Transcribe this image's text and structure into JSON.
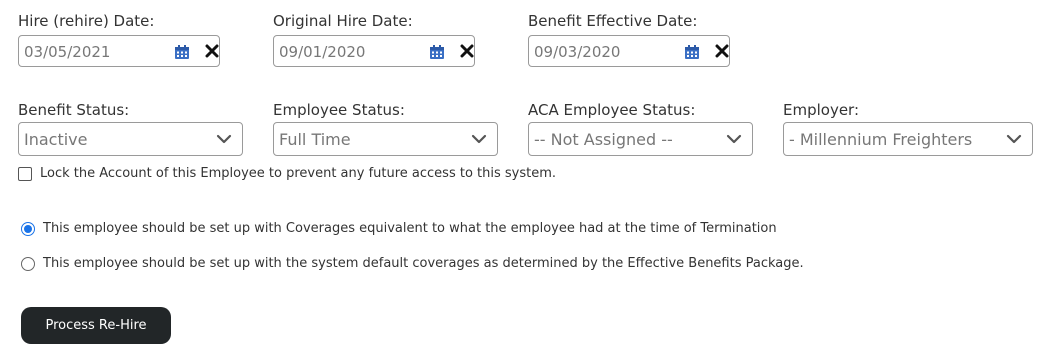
{
  "dates": {
    "hire": {
      "label": "Hire (rehire) Date:",
      "value": "03/05/2021"
    },
    "original": {
      "label": "Original Hire Date:",
      "value": "09/01/2020"
    },
    "benefit_effective": {
      "label": "Benefit Effective Date:",
      "value": "09/03/2020"
    }
  },
  "selects": {
    "benefit_status": {
      "label": "Benefit Status:",
      "value": "Inactive"
    },
    "employee_status": {
      "label": "Employee Status:",
      "value": "Full Time"
    },
    "aca_status": {
      "label": "ACA Employee Status:",
      "value": "-- Not Assigned --"
    },
    "employer": {
      "label": "Employer:",
      "value": "- Millennium Freighters"
    }
  },
  "lock_account": {
    "label": "Lock the Account of this Employee to prevent any future access to this system.",
    "checked": false
  },
  "coverage_options": [
    {
      "label": "This employee should be set up with Coverages equivalent to what the employee had at the time of Termination",
      "selected": true
    },
    {
      "label": "This employee should be set up with the system default coverages as determined by the Effective Benefits Package.",
      "selected": false
    }
  ],
  "actions": {
    "process_label": "Process Re-Hire"
  },
  "colors": {
    "calendar_icon": "#3a6fc4",
    "radio_accent": "#1a73e8",
    "button_bg": "#222628"
  },
  "icons": {
    "calendar": "calendar-icon",
    "clear": "clear-x-icon",
    "dropdown": "chevron-down-icon"
  }
}
